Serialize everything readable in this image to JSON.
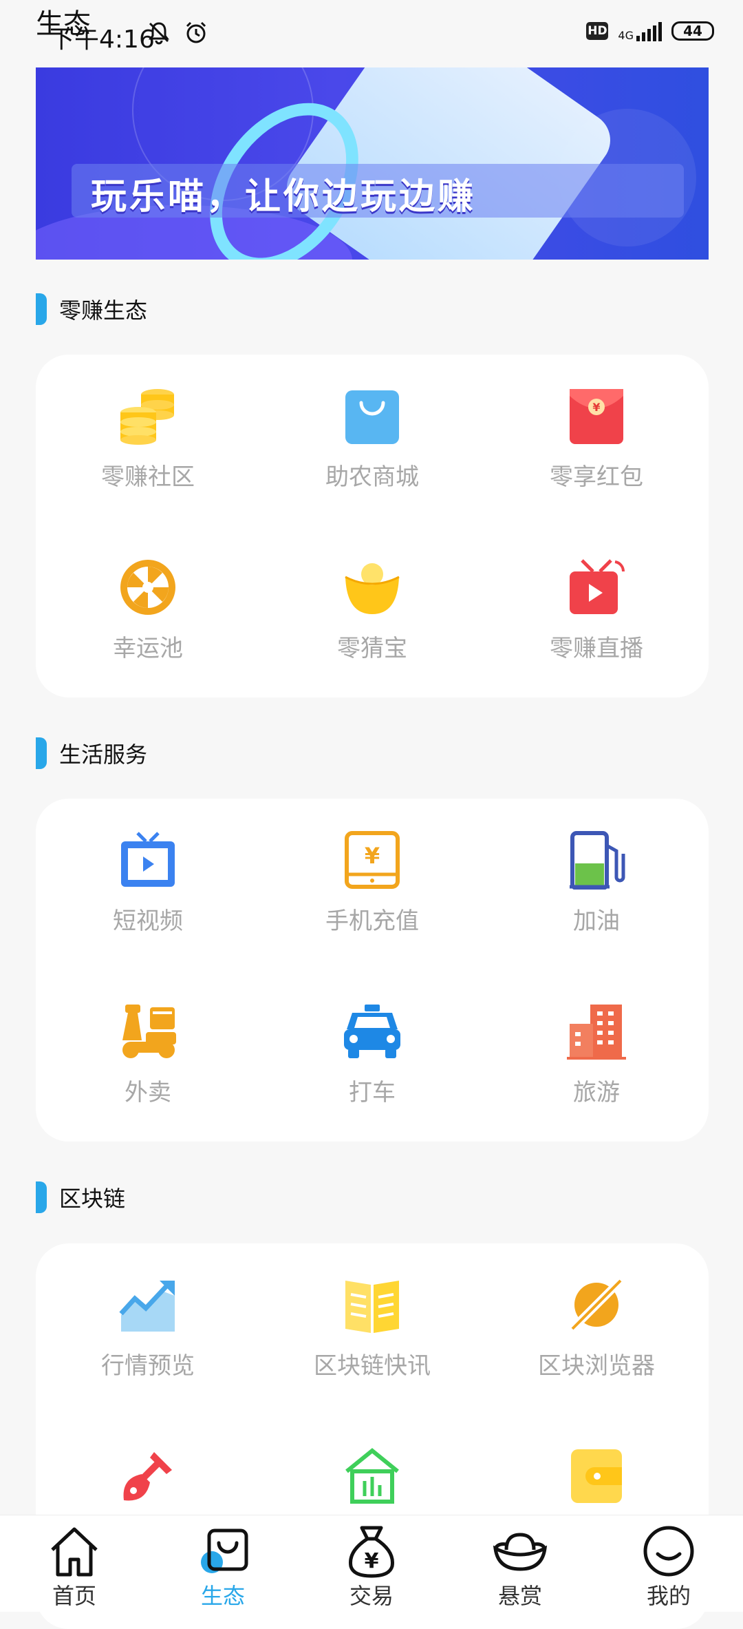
{
  "page_title": "生态",
  "status_bar": {
    "time": "下午4:16",
    "hd": "HD",
    "network": "4G",
    "battery": "44"
  },
  "banner": {
    "slogan": "玩乐喵，让你边玩边赚"
  },
  "sections": [
    {
      "title": "零赚生态",
      "items": [
        {
          "label": "零赚社区",
          "icon": "coins-icon"
        },
        {
          "label": "助农商城",
          "icon": "shopping-bag-icon"
        },
        {
          "label": "零享红包",
          "icon": "red-envelope-icon"
        },
        {
          "label": "幸运池",
          "icon": "lucky-wheel-icon"
        },
        {
          "label": "零猜宝",
          "icon": "gold-ingot-icon"
        },
        {
          "label": "零赚直播",
          "icon": "live-tv-icon"
        }
      ]
    },
    {
      "title": "生活服务",
      "items": [
        {
          "label": "短视频",
          "icon": "video-tv-icon"
        },
        {
          "label": "手机充值",
          "icon": "phone-recharge-icon"
        },
        {
          "label": "加油",
          "icon": "gas-station-icon"
        },
        {
          "label": "外卖",
          "icon": "delivery-scooter-icon"
        },
        {
          "label": "打车",
          "icon": "taxi-icon"
        },
        {
          "label": "旅游",
          "icon": "buildings-icon"
        }
      ]
    },
    {
      "title": "区块链",
      "items": [
        {
          "label": "行情预览",
          "icon": "market-chart-icon"
        },
        {
          "label": "区块链快讯",
          "icon": "news-book-icon"
        },
        {
          "label": "区块浏览器",
          "icon": "planet-icon"
        },
        {
          "label": "",
          "icon": "shovel-icon"
        },
        {
          "label": "",
          "icon": "bank-icon"
        },
        {
          "label": "",
          "icon": "wallet-icon"
        }
      ]
    }
  ],
  "tabs": [
    {
      "label": "首页",
      "icon": "home-icon",
      "active": false
    },
    {
      "label": "生态",
      "icon": "ecosystem-bag-icon",
      "active": true
    },
    {
      "label": "交易",
      "icon": "money-bag-icon",
      "active": false
    },
    {
      "label": "悬赏",
      "icon": "ingot-icon",
      "active": false
    },
    {
      "label": "我的",
      "icon": "smile-face-icon",
      "active": false
    }
  ],
  "colors": {
    "accent": "#29a7e9",
    "label_gray": "#a7a7a7",
    "background": "#f7f7f7"
  }
}
